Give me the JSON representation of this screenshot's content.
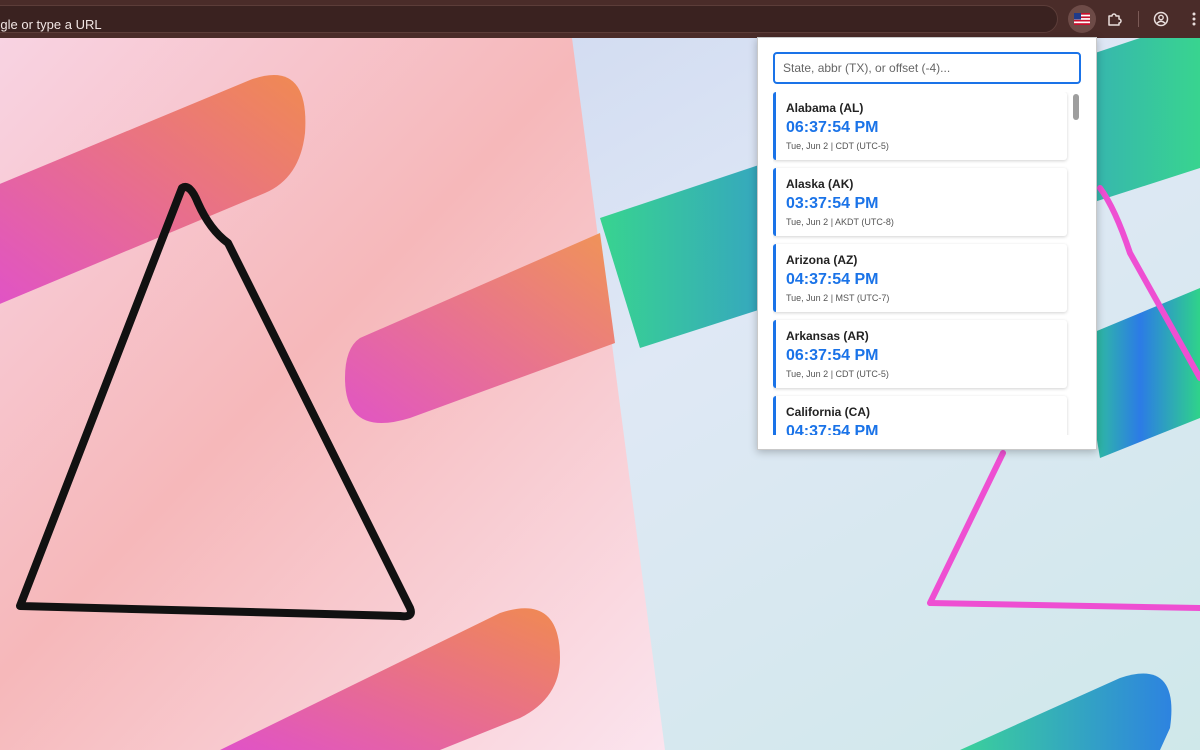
{
  "browser": {
    "omnibox_text": "h Google or type a URL",
    "icons": [
      "us-flag-icon",
      "puzzle-icon",
      "profile-icon",
      "kebab-menu-icon"
    ]
  },
  "popup": {
    "search_placeholder": "State, abbr (TX), or offset (-4)...",
    "states": [
      {
        "name": "Alabama (AL)",
        "time": "06:37:54 PM",
        "meta": "Tue, Jun 2 | CDT (UTC-5)"
      },
      {
        "name": "Alaska (AK)",
        "time": "03:37:54 PM",
        "meta": "Tue, Jun 2 | AKDT (UTC-8)"
      },
      {
        "name": "Arizona (AZ)",
        "time": "04:37:54 PM",
        "meta": "Tue, Jun 2 | MST (UTC-7)"
      },
      {
        "name": "Arkansas (AR)",
        "time": "06:37:54 PM",
        "meta": "Tue, Jun 2 | CDT (UTC-5)"
      },
      {
        "name": "California (CA)",
        "time": "04:37:54 PM",
        "meta": ""
      }
    ]
  },
  "colors": {
    "accent": "#1a73e8",
    "toolbar": "#4a2c29"
  }
}
